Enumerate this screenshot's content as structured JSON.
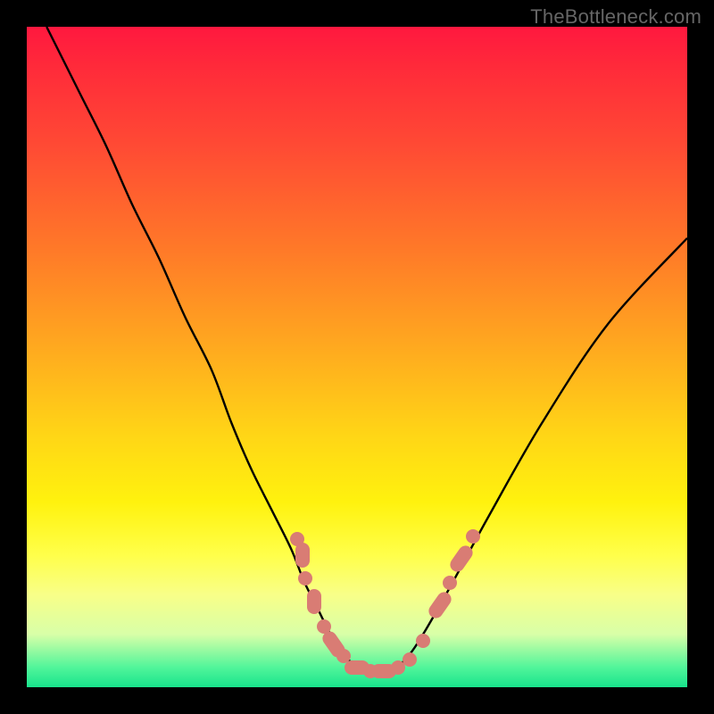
{
  "watermark": "TheBottleneck.com",
  "colors": {
    "background": "#000000",
    "gradient_top": "#ff183f",
    "gradient_bottom": "#18e38c",
    "curve": "#000000",
    "marker": "#d97c74",
    "watermark": "#666666"
  },
  "chart_data": {
    "type": "line",
    "title": "",
    "xlabel": "",
    "ylabel": "",
    "xlim": [
      0,
      100
    ],
    "ylim": [
      0,
      100
    ],
    "series": [
      {
        "name": "bottleneck-curve",
        "x": [
          3,
          8,
          12,
          16,
          20,
          24,
          28,
          31,
          34,
          37,
          40,
          42,
          44,
          46,
          48,
          50,
          52,
          54,
          56,
          58,
          60,
          64,
          70,
          78,
          88,
          100
        ],
        "y": [
          100,
          90,
          82,
          73,
          65,
          56,
          48,
          40,
          33,
          27,
          21,
          16,
          12,
          8,
          5,
          3,
          2,
          2,
          3,
          5,
          8,
          15,
          26,
          40,
          55,
          68
        ]
      }
    ],
    "markers": [
      {
        "u": 41.0,
        "v": 22.5,
        "shape": "dot"
      },
      {
        "u": 41.7,
        "v": 20.0,
        "shape": "pill-tall"
      },
      {
        "u": 42.2,
        "v": 16.5,
        "shape": "dot"
      },
      {
        "u": 43.5,
        "v": 13.0,
        "shape": "pill-tall"
      },
      {
        "u": 45.0,
        "v": 9.2,
        "shape": "dot"
      },
      {
        "u": 46.5,
        "v": 6.5,
        "shape": "pill-diag",
        "rot": 55
      },
      {
        "u": 48.0,
        "v": 4.8,
        "shape": "dot"
      },
      {
        "u": 50.0,
        "v": 3.0,
        "shape": "pill"
      },
      {
        "u": 52.0,
        "v": 2.5,
        "shape": "dot"
      },
      {
        "u": 54.0,
        "v": 2.5,
        "shape": "pill"
      },
      {
        "u": 56.2,
        "v": 3.0,
        "shape": "dot"
      },
      {
        "u": 58.0,
        "v": 4.2,
        "shape": "dot"
      },
      {
        "u": 60.0,
        "v": 7.0,
        "shape": "dot"
      },
      {
        "u": 62.5,
        "v": 12.5,
        "shape": "pill-diag",
        "rot": -55
      },
      {
        "u": 64.0,
        "v": 15.8,
        "shape": "dot"
      },
      {
        "u": 65.8,
        "v": 19.5,
        "shape": "pill-diag",
        "rot": -55
      },
      {
        "u": 67.5,
        "v": 22.8,
        "shape": "dot"
      }
    ],
    "note": "x and y are normalized 0–100 across the plot area; y=0 is the bottom (green), y=100 is the top (red). Values are visual estimates from unlabeled axes."
  }
}
